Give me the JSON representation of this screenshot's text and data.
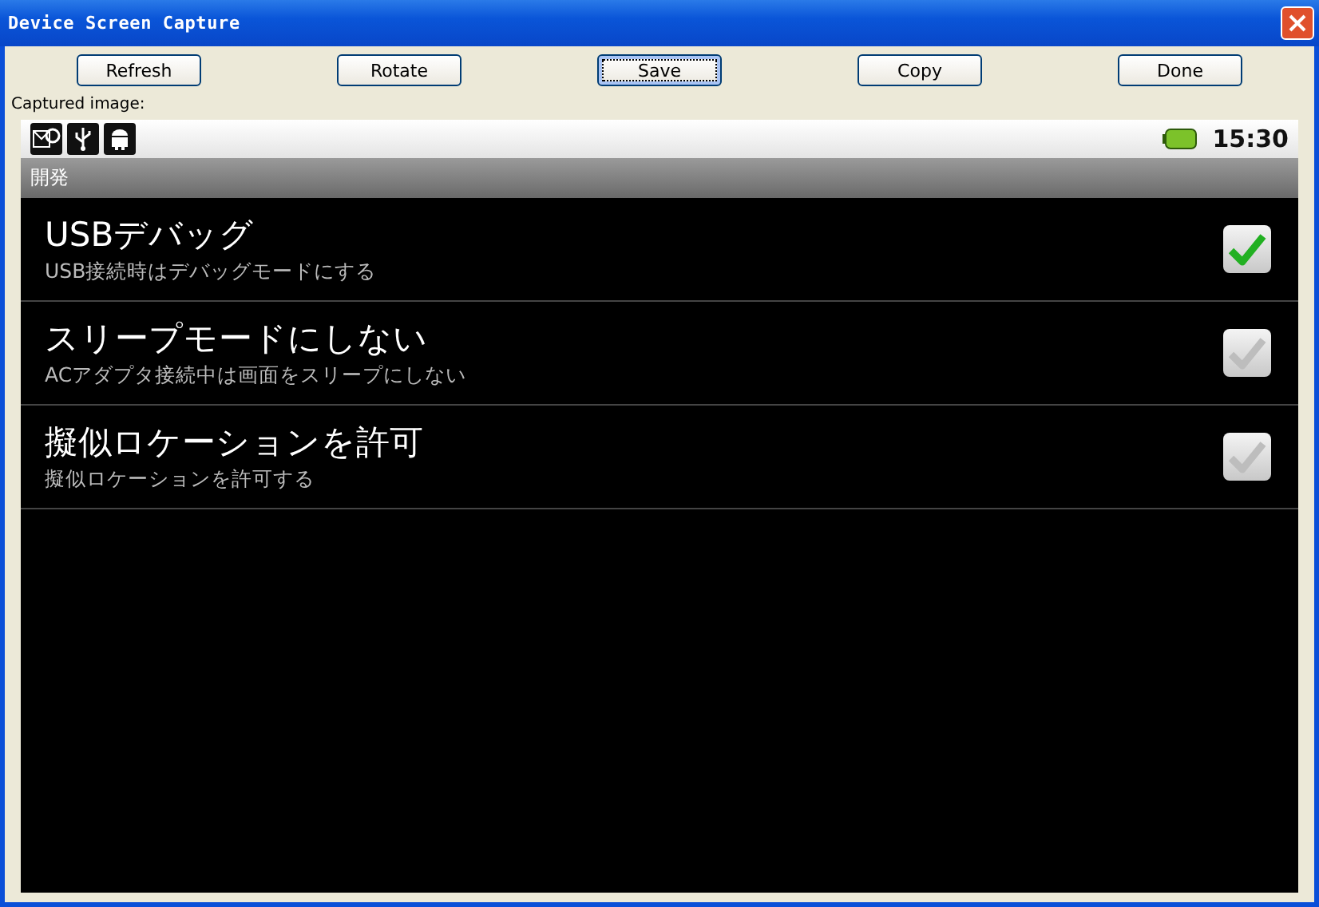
{
  "window": {
    "title": "Device Screen Capture"
  },
  "buttons": [
    {
      "label": "Refresh",
      "focused": false
    },
    {
      "label": "Rotate",
      "focused": false
    },
    {
      "label": "Save",
      "focused": true
    },
    {
      "label": "Copy",
      "focused": false
    },
    {
      "label": "Done",
      "focused": false
    }
  ],
  "captured_label": "Captured image:",
  "device": {
    "status_bar": {
      "time": "15:30"
    },
    "header": "開発",
    "settings": [
      {
        "title": "USBデバッグ",
        "summary": "USB接続時はデバッグモードにする",
        "checked": true
      },
      {
        "title": "スリープモードにしない",
        "summary": "ACアダプタ接続中は画面をスリープにしない",
        "checked": false
      },
      {
        "title": "擬似ロケーションを許可",
        "summary": "擬似ロケーションを許可する",
        "checked": false
      }
    ]
  }
}
